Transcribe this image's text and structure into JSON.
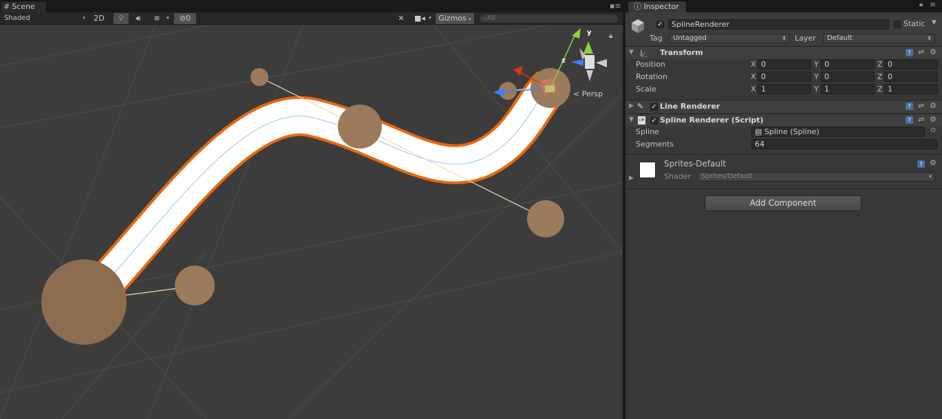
{
  "scene": {
    "tab_title": "Scene",
    "shading_mode": "Shaded",
    "mode_2d": "2D",
    "hidden_count": "0",
    "gizmos_label": "Gizmos",
    "search_placeholder": "All",
    "projection_label": "Persp",
    "gizmo_axes": {
      "y": "y",
      "z": "z"
    },
    "icons": [
      "lighting-icon",
      "audio-icon",
      "effects-icon",
      "hidden-objects-icon",
      "tools-icon",
      "camera-icon",
      "search-icon",
      "lock-icon",
      "menu-icon"
    ]
  },
  "inspector": {
    "tab_title": "Inspector",
    "object": {
      "name": "SplineRenderer",
      "active": true,
      "static_label": "Static",
      "static_checked": false,
      "tag_label": "Tag",
      "tag_value": "Untagged",
      "layer_label": "Layer",
      "layer_value": "Default"
    },
    "transform": {
      "title": "Transform",
      "position": {
        "label": "Position",
        "x": "0",
        "y": "0",
        "z": "0"
      },
      "rotation": {
        "label": "Rotation",
        "x": "0",
        "y": "0",
        "z": "0"
      },
      "scale": {
        "label": "Scale",
        "x": "1",
        "y": "1",
        "z": "1"
      },
      "axis_x": "X",
      "axis_y": "Y",
      "axis_z": "Z"
    },
    "line_renderer": {
      "title": "Line Renderer",
      "enabled": true
    },
    "spline_renderer": {
      "title": "Spline Renderer (Script)",
      "enabled": true,
      "spline_label": "Spline",
      "spline_value": "Spline (Spline)",
      "segments_label": "Segments",
      "segments_value": "64"
    },
    "material": {
      "name": "Sprites-Default",
      "shader_label": "Shader",
      "shader_value": "Sprites/Default"
    },
    "add_component_label": "Add Component"
  },
  "colors": {
    "accent_orange": "#e8690f",
    "sphere": "#9b7b5b",
    "axis_x": "#d8331f",
    "axis_y": "#8dd13a",
    "axis_z": "#3f7df2"
  }
}
